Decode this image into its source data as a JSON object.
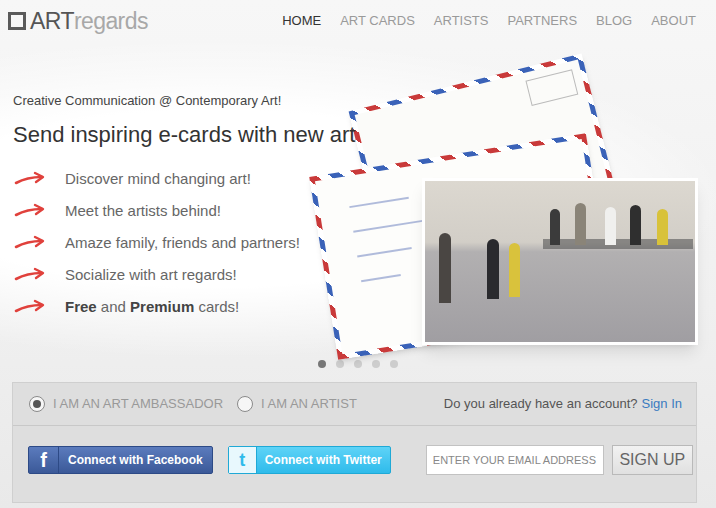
{
  "logo": {
    "parts": [
      "ART",
      "regards"
    ]
  },
  "nav": [
    {
      "label": "HOME",
      "selected": true
    },
    {
      "label": "ART CARDS",
      "selected": false
    },
    {
      "label": "ARTISTS",
      "selected": false
    },
    {
      "label": "PARTNERS",
      "selected": false
    },
    {
      "label": "BLOG",
      "selected": false
    },
    {
      "label": "ABOUT",
      "selected": false
    }
  ],
  "hero": {
    "tagline": "Creative Communication @ Contemporary Art!",
    "headline": "Send inspiring e-cards with new art",
    "features": [
      {
        "parts": [
          {
            "text": "Discover mind changing art!",
            "bold": false
          }
        ]
      },
      {
        "parts": [
          {
            "text": "Meet the artists behind!",
            "bold": false
          }
        ]
      },
      {
        "parts": [
          {
            "text": "Amaze family, friends and partners!",
            "bold": false
          }
        ]
      },
      {
        "parts": [
          {
            "text": "Socialize with art regards!",
            "bold": false
          }
        ]
      },
      {
        "parts": [
          {
            "text": "Free",
            "bold": true
          },
          {
            "text": " and ",
            "bold": false
          },
          {
            "text": "Premium",
            "bold": true
          },
          {
            "text": " cards!",
            "bold": false
          }
        ]
      }
    ]
  },
  "carousel": {
    "dots": [
      {
        "selected": true
      },
      {
        "selected": false
      },
      {
        "selected": false
      },
      {
        "selected": false
      },
      {
        "selected": false
      }
    ]
  },
  "signup": {
    "roles": [
      {
        "label": "I AM AN ART AMBASSADOR",
        "selected": true
      },
      {
        "label": "I AM AN ARTIST",
        "selected": false
      }
    ],
    "account_prompt": "Do you already have an account?",
    "sign_in": "Sign In",
    "facebook": {
      "icon": "f",
      "label": "Connect with Facebook"
    },
    "twitter": {
      "icon": "t",
      "label": "Connect with Twitter"
    },
    "email_placeholder": "ENTER YOUR EMAIL ADDRESS",
    "submit": "SIGN UP"
  }
}
